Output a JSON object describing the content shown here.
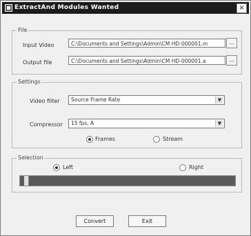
{
  "window": {
    "title": "ExtractAnd Modules Wanted",
    "close_label": "×"
  },
  "files": {
    "group_label": "File",
    "input_label": "Input Video",
    "input_value": "C:\\Documents and Settings\\Admin\\CM HD-000001.m",
    "output_label": "Output file",
    "output_value": "C:\\Documents and Settings\\Admin\\CM HD-000001.a",
    "browse_label": "..."
  },
  "settings": {
    "group_label": "Settings",
    "video_filter_label": "Video filter",
    "video_filter_value": "Source Frame Rate",
    "compressor_label": "Compressor",
    "compressor_value": "15 fps, A",
    "radio_a_label": "Frames",
    "radio_b_label": "Stream",
    "radio_selected": "Frames"
  },
  "selection": {
    "group_label": "Selection",
    "radio_a_label": "Left",
    "radio_b_label": "Right",
    "radio_selected": "Left",
    "progress": 0.02
  },
  "buttons": {
    "convert_label": "Convert",
    "exit_label": "Exit"
  }
}
